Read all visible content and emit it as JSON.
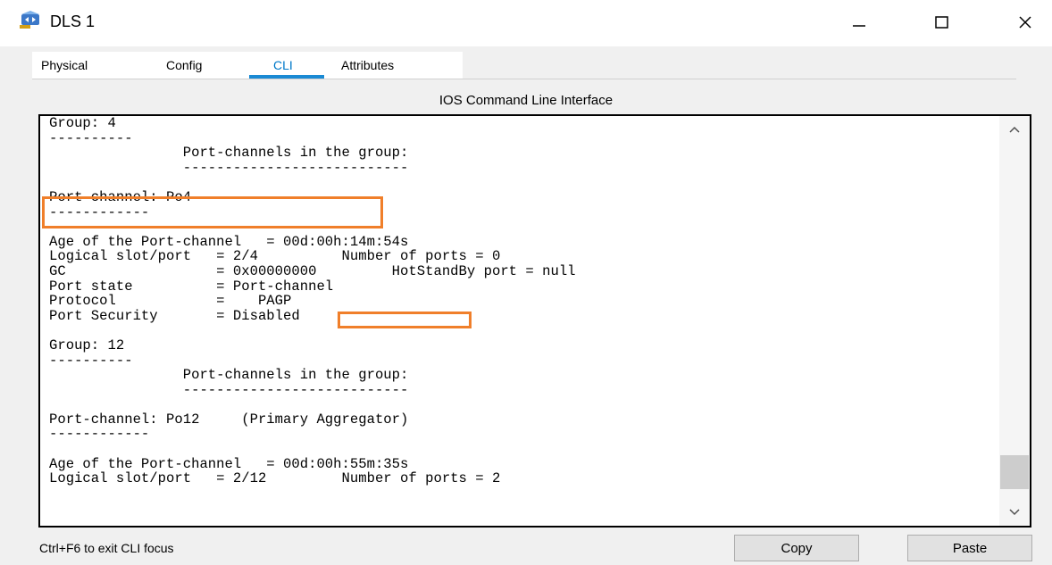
{
  "window": {
    "title": "DLS 1",
    "icon": "packet-tracer-switch-icon"
  },
  "tabs": [
    {
      "label": "Physical"
    },
    {
      "label": "Config"
    },
    {
      "label": "CLI",
      "active": true
    },
    {
      "label": "Attributes"
    }
  ],
  "heading": "IOS Command Line Interface",
  "console": {
    "text": "Group: 4\n----------\n                Port-channels in the group:\n                ---------------------------\n\nPort-channel: Po4\n------------\n\nAge of the Port-channel   = 00d:00h:14m:54s\nLogical slot/port   = 2/4          Number of ports = 0\nGC                  = 0x00000000         HotStandBy port = null\nPort state          = Port-channel\nProtocol            =    PAGP\nPort Security       = Disabled\n\nGroup: 12\n----------\n                Port-channels in the group:\n                ---------------------------\n\nPort-channel: Po12     (Primary Aggregator)\n------------\n\nAge of the Port-channel   = 00d:00h:55m:35s\nLogical slot/port   = 2/12         Number of ports = 2",
    "highlight_color": "#f07f2a"
  },
  "footer": {
    "hint": "Ctrl+F6 to exit CLI focus",
    "copy_label": "Copy",
    "paste_label": "Paste"
  },
  "colors": {
    "active_tab": "#0079c9",
    "tab_underline": "#1a8ad4"
  }
}
